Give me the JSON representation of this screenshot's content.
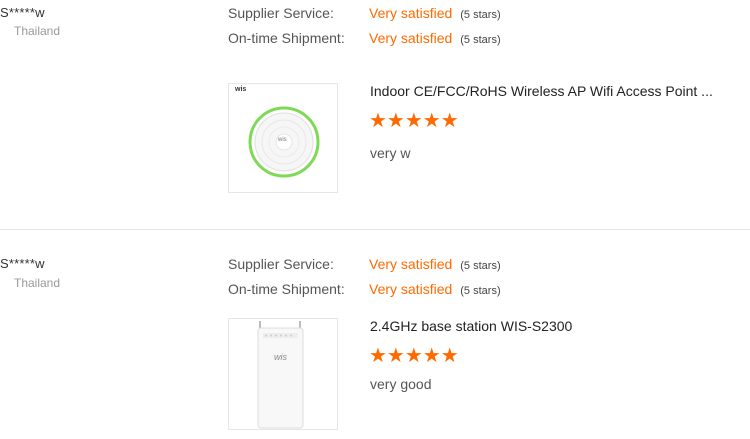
{
  "reviews": [
    {
      "buyer": "S*****w",
      "country": "Thailand",
      "supplier_service_label": "Supplier Service:",
      "supplier_service_value": "Very satisfied",
      "supplier_service_stars": "(5 stars)",
      "shipment_label": "On-time Shipment:",
      "shipment_value": "Very satisfied",
      "shipment_stars": "(5 stars)",
      "product_title": "Indoor CE/FCC/RoHS Wireless AP Wifi Access Point ...",
      "product_logo": "wis",
      "product_center_text": "wis",
      "rating": 5,
      "stars": "★★★★★",
      "comment": "very w"
    },
    {
      "buyer": "S*****w",
      "country": "Thailand",
      "supplier_service_label": "Supplier Service:",
      "supplier_service_value": "Very satisfied",
      "supplier_service_stars": "(5 stars)",
      "shipment_label": "On-time Shipment:",
      "shipment_value": "Very satisfied",
      "shipment_stars": "(5 stars)",
      "product_title": "2.4GHz base station WIS-S2300",
      "product_logo": "wis",
      "rating": 5,
      "stars": "★★★★★",
      "comment": "very good"
    }
  ],
  "colors": {
    "accent": "#ff6a00",
    "ring": "#7ed957",
    "divider": "#e5e5e5"
  }
}
